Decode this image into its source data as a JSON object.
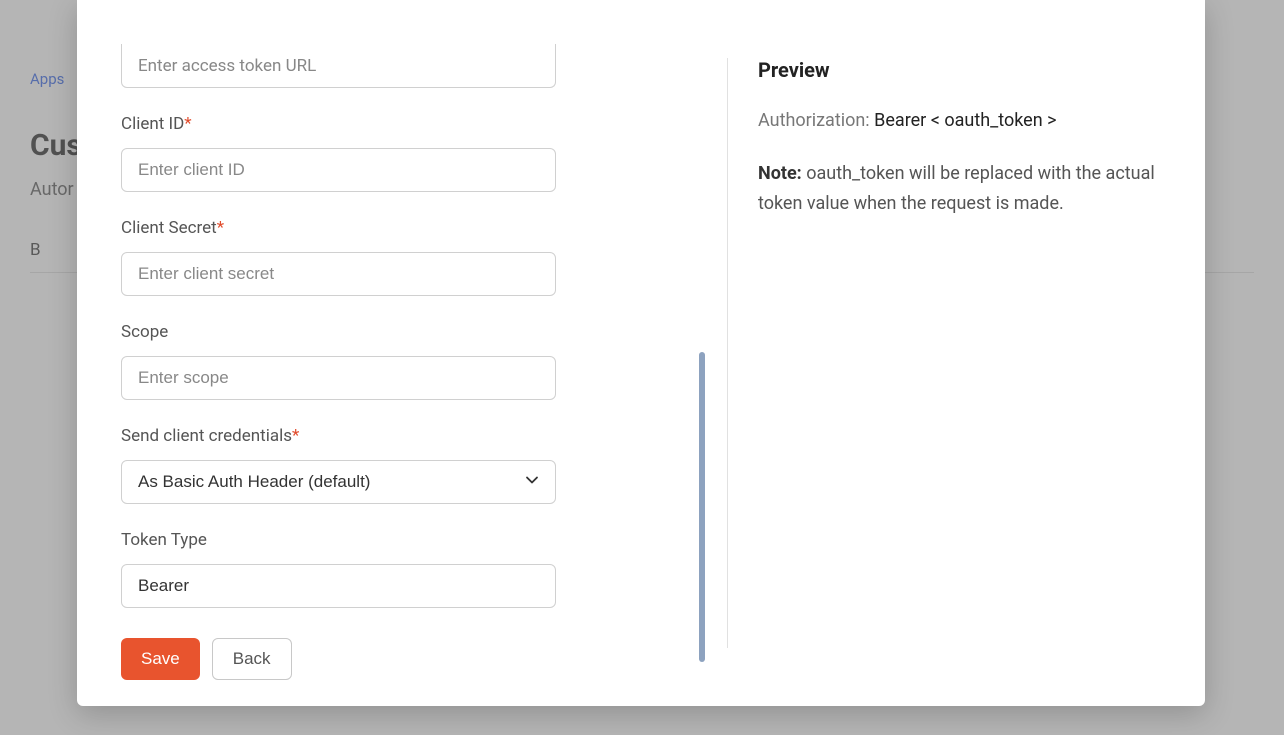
{
  "background": {
    "breadcrumb_first": "Apps",
    "title_partial": "Cus",
    "sub_partial": "Autor",
    "tab_partial": "B"
  },
  "form": {
    "access_token_url": {
      "placeholder": "Enter access token URL"
    },
    "client_id": {
      "label": "Client ID",
      "placeholder": "Enter client ID",
      "required": true
    },
    "client_secret": {
      "label": "Client Secret",
      "placeholder": "Enter client secret",
      "required": true
    },
    "scope": {
      "label": "Scope",
      "placeholder": "Enter scope",
      "required": false
    },
    "send_creds": {
      "label": "Send client credentials",
      "value": "As Basic Auth Header (default)",
      "required": true
    },
    "token_type": {
      "label": "Token Type",
      "value": "Bearer",
      "required": false
    }
  },
  "buttons": {
    "save": "Save",
    "back": "Back"
  },
  "preview": {
    "heading": "Preview",
    "auth_label": "Authorization: ",
    "auth_value": "Bearer < oauth_token >",
    "note_prefix": "Note:",
    "note_body": " oauth_token will be replaced with the actual token value when the request is made."
  }
}
